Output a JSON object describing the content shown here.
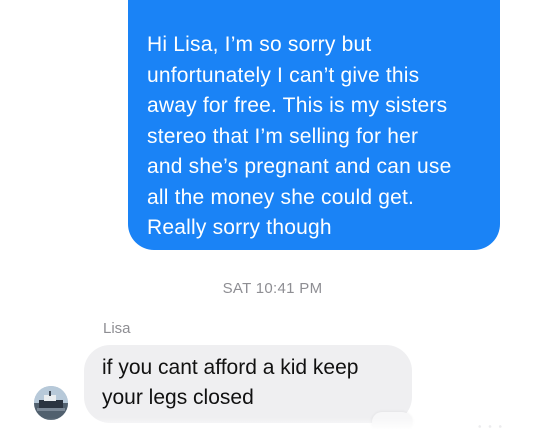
{
  "outgoing_message": {
    "lines": [
      "Hi Lisa, I’m so sorry but",
      "unfortunately I can’t give this",
      "away for free. This is my sisters",
      "stereo that I’m selling for her",
      "and she’s pregnant and can use",
      "all the money she could get.",
      "Really sorry though"
    ],
    "color": "#1a83f6"
  },
  "timestamp": "SAT 10:41 PM",
  "incoming_message": {
    "sender": "Lisa",
    "lines": [
      "if you cant afford a kid keep",
      "your legs closed"
    ],
    "color": "#efeff1"
  },
  "avatar": {
    "icon": "boat-photo-avatar"
  }
}
